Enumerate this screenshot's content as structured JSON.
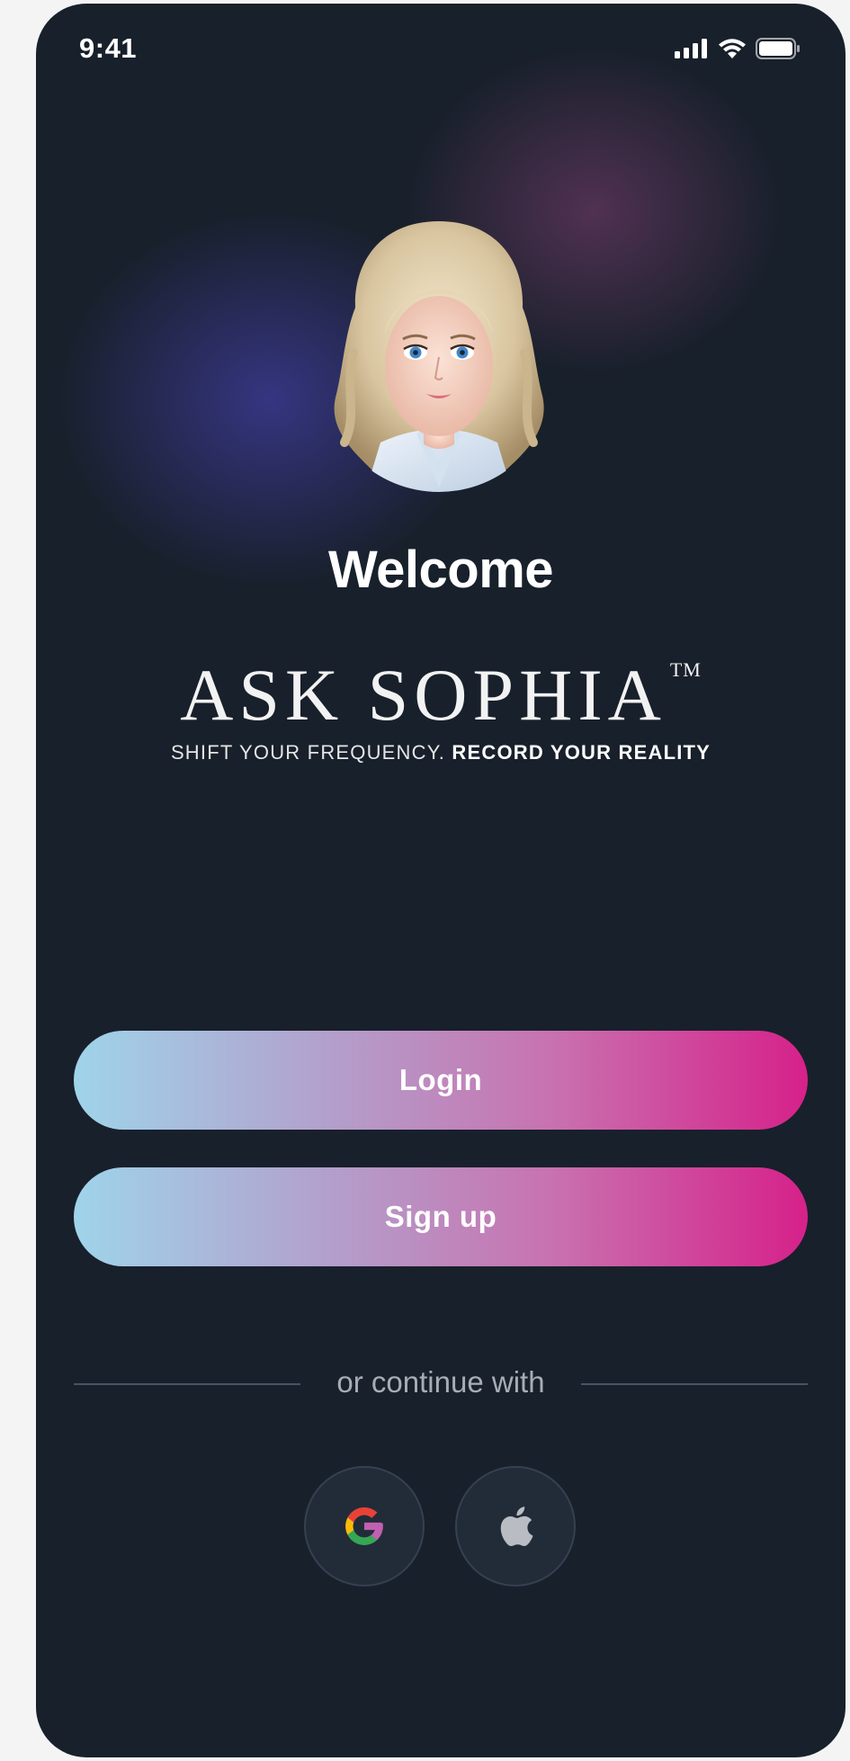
{
  "status_bar": {
    "time": "9:41",
    "icons": [
      "cellular-signal-icon",
      "wifi-icon",
      "battery-icon"
    ]
  },
  "hero": {
    "avatar": "sophia-avatar",
    "welcome": "Welcome",
    "brand_name": "ASK SOPHIA",
    "trademark": "TM",
    "tagline_part1": "SHIFT YOUR FREQUENCY.",
    "tagline_part2": "RECORD YOUR REALITY"
  },
  "actions": {
    "login_label": "Login",
    "signup_label": "Sign up"
  },
  "divider": {
    "text": "or continue with"
  },
  "social": {
    "buttons": [
      {
        "icon": "google-icon"
      },
      {
        "icon": "apple-icon"
      }
    ]
  },
  "colors": {
    "background": "#18202b",
    "gradient_start": "#9fd4ea",
    "gradient_end": "#d6218a",
    "social_button_bg": "#222c38"
  }
}
